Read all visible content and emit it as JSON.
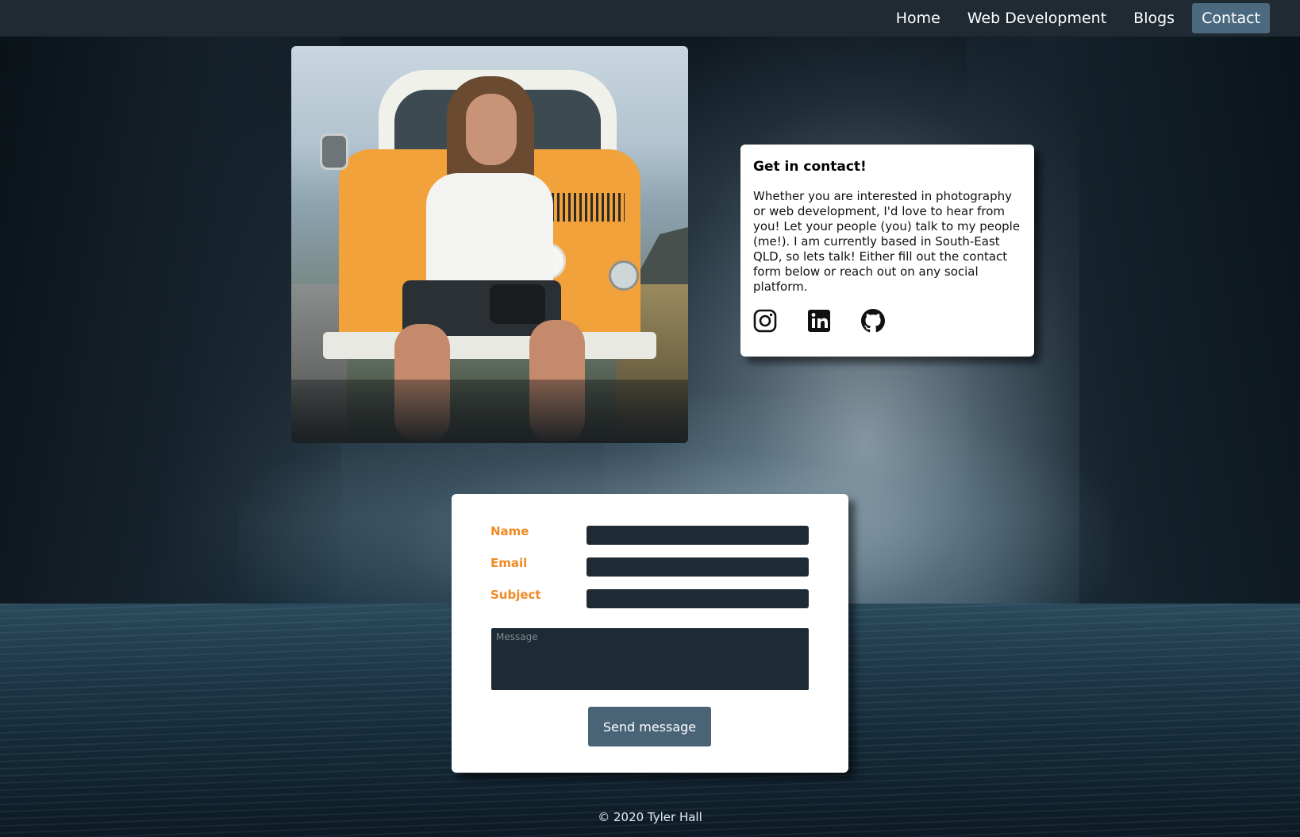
{
  "nav": {
    "items": [
      {
        "label": "Home",
        "active": false
      },
      {
        "label": "Web Development",
        "active": false
      },
      {
        "label": "Blogs",
        "active": false
      },
      {
        "label": "Contact",
        "active": true
      }
    ]
  },
  "contact": {
    "title": "Get in contact!",
    "body": "Whether you are interested in photography or web development, I'd love to hear from you! Let your people (you) talk to my people (me!). I am currently based in South-East QLD, so lets talk! Either fill out the contact form below or reach out on any social platform.",
    "socials": [
      "instagram-icon",
      "linkedin-icon",
      "github-icon"
    ]
  },
  "form": {
    "name_label": "Name",
    "email_label": "Email",
    "subject_label": "Subject",
    "name_value": "",
    "email_value": "",
    "subject_value": "",
    "message_placeholder": "Message",
    "send_label": "Send message"
  },
  "footer": {
    "text": "© 2020 Tyler Hall"
  },
  "colors": {
    "navbar": "#1f2a33",
    "active_nav": "#4b6a80",
    "label_accent": "#f08a24",
    "input_bg": "#1f2b34",
    "button_bg": "#4a6477"
  }
}
